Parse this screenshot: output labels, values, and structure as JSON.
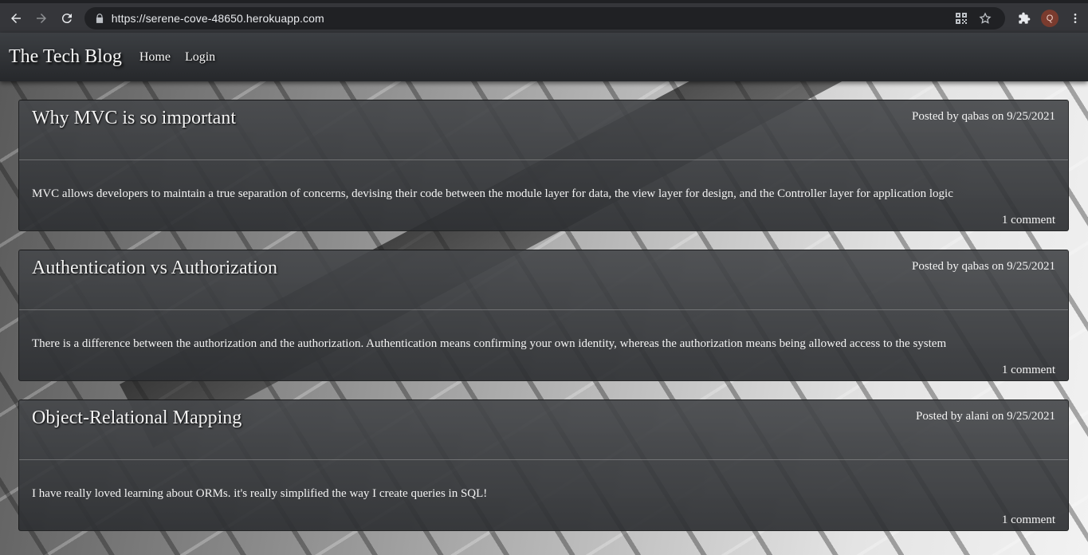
{
  "browser": {
    "url": "https://serene-cove-48650.herokuapp.com",
    "profile_initial": "Q",
    "icons": [
      "back-icon",
      "forward-icon",
      "reload-icon",
      "lock-icon",
      "qr-code-icon",
      "star-icon",
      "extensions-icon",
      "menu-icon"
    ]
  },
  "site": {
    "title": "The Tech Blog",
    "nav": [
      {
        "label": "Home"
      },
      {
        "label": "Login"
      }
    ]
  },
  "posts": [
    {
      "title": "Why MVC is so important",
      "meta": "Posted by qabas on 9/25/2021",
      "body": "MVC allows developers to maintain a true separation of concerns, devising their code between the module layer for data, the view layer for design, and the Controller layer for application logic",
      "comments": "1 comment"
    },
    {
      "title": "Authentication vs Authorization",
      "meta": "Posted by qabas on 9/25/2021",
      "body": "There is a difference between the authorization and the authorization. Authentication means confirming your own identity, whereas the authorization means being allowed access to the system",
      "comments": "1 comment"
    },
    {
      "title": "Object-Relational Mapping",
      "meta": "Posted by alani on 9/25/2021",
      "body": "I have really loved learning about ORMs. it's really simplified the way I create queries in SQL!",
      "comments": "1 comment"
    }
  ]
}
